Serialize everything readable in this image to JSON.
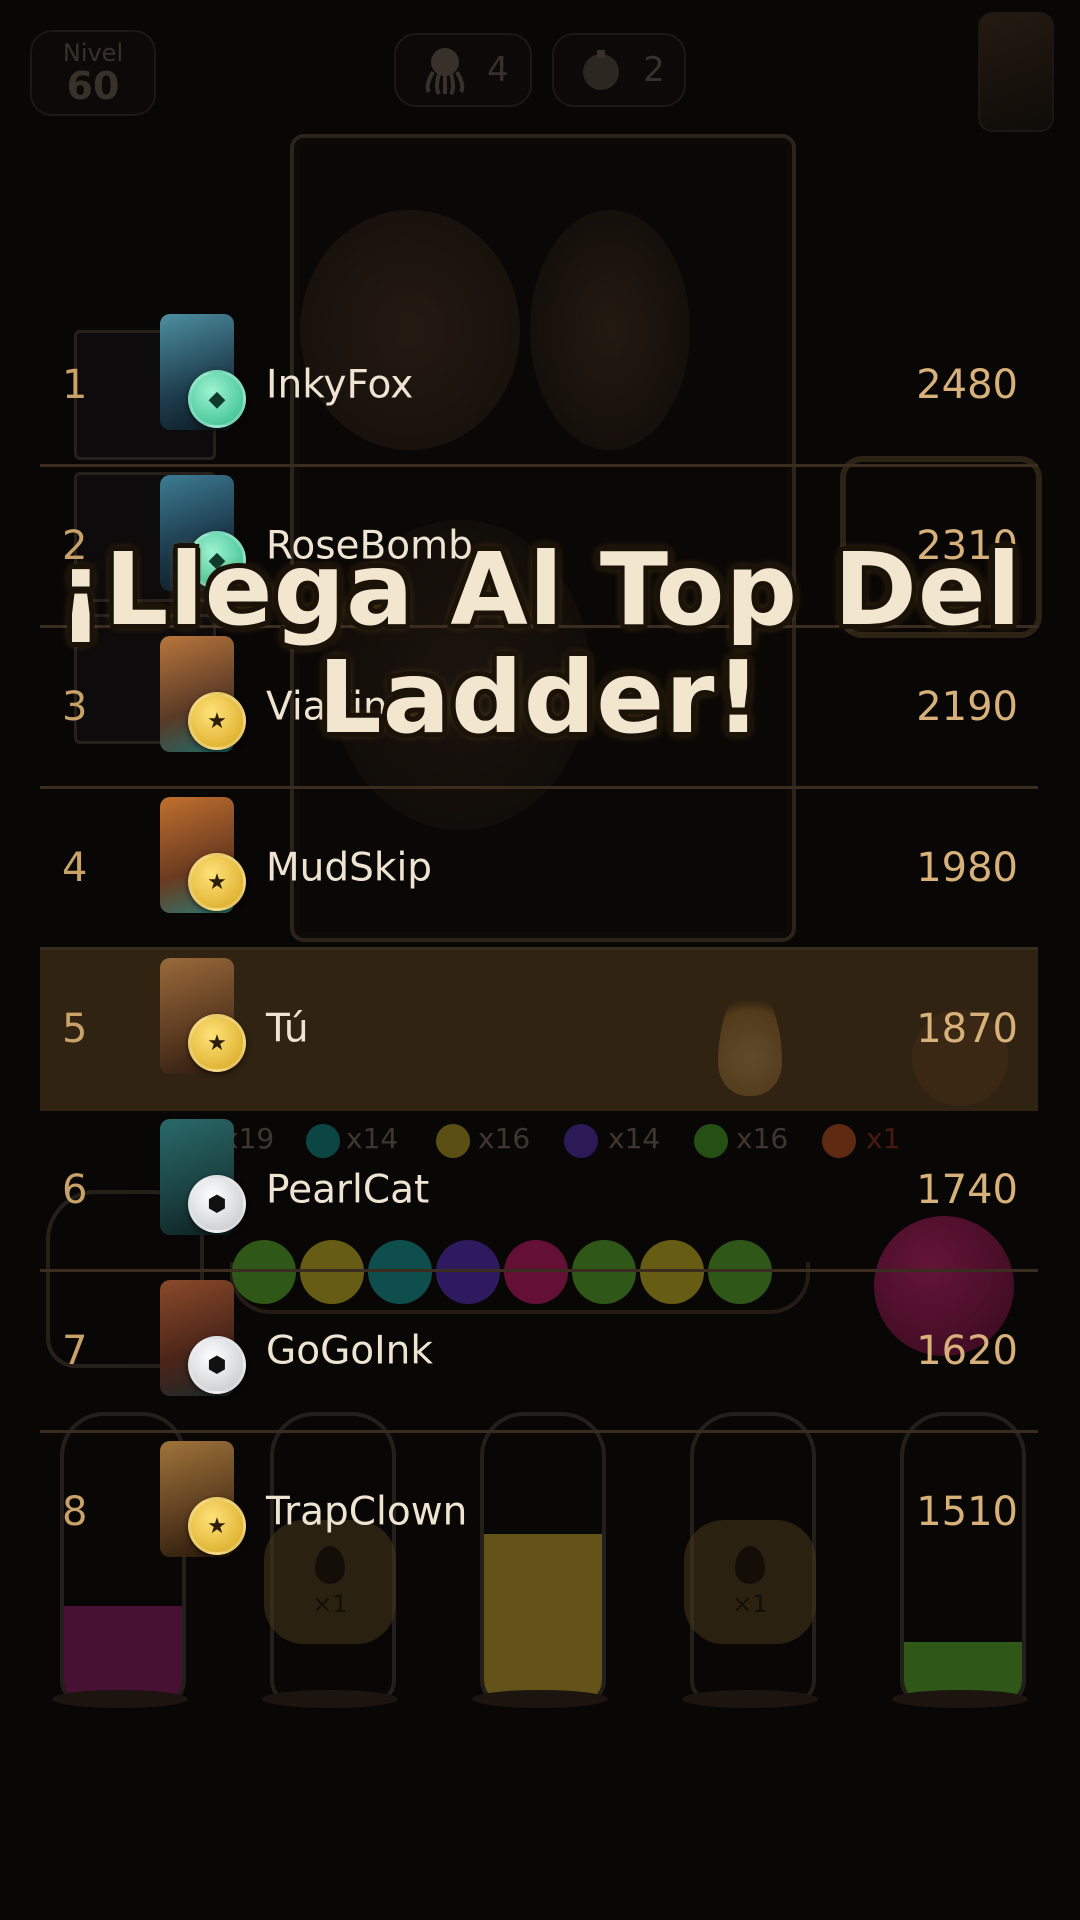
{
  "hud": {
    "level_label": "Nivel",
    "level_value": "60",
    "counter_a": "4",
    "counter_b": "2"
  },
  "ball_counts": [
    "x19",
    "x14",
    "x16",
    "x14",
    "x16",
    "x1"
  ],
  "drop_badges": [
    "×1",
    "×1"
  ],
  "leaderboard": [
    {
      "rank": "1",
      "name": "InkyFox",
      "score": "2480",
      "badge": "diamond"
    },
    {
      "rank": "2",
      "name": "RoseBomb",
      "score": "2310",
      "badge": "diamond"
    },
    {
      "rank": "3",
      "name": "ViaKin",
      "score": "2190",
      "badge": "gold"
    },
    {
      "rank": "4",
      "name": "MudSkip",
      "score": "1980",
      "badge": "gold"
    },
    {
      "rank": "5",
      "name": "Tú",
      "score": "1870",
      "badge": "gold"
    },
    {
      "rank": "6",
      "name": "PearlCat",
      "score": "1740",
      "badge": "silver"
    },
    {
      "rank": "7",
      "name": "GoGoInk",
      "score": "1620",
      "badge": "silver"
    },
    {
      "rank": "8",
      "name": "TrapClown",
      "score": "1510",
      "badge": "gold"
    }
  ],
  "headline": {
    "line1": "¡Llega Al Top Del",
    "line2": "Ladder!"
  },
  "colors": {
    "highlight_row": "#503a1e",
    "score": "#d8b07a",
    "rank": "#c9a26a"
  }
}
